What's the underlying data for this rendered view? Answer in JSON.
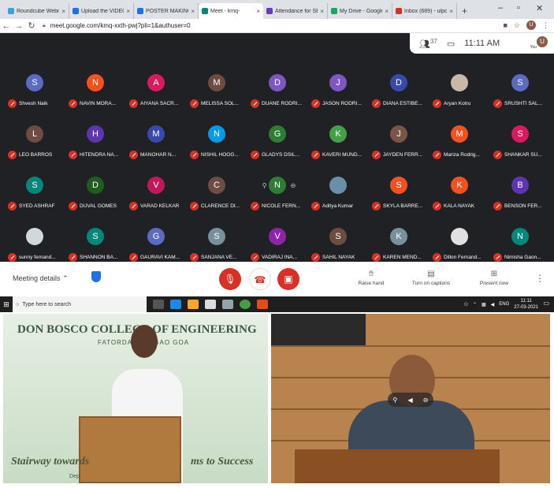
{
  "browser": {
    "tabs": [
      {
        "title": "Roundcube Webm",
        "color": "#37a3d8"
      },
      {
        "title": "Upload the VIDEO",
        "color": "#1a73e8"
      },
      {
        "title": "POSTER MAKING",
        "color": "#1a73e8"
      },
      {
        "title": "Meet - kmq-",
        "color": "#00897b",
        "active": true
      },
      {
        "title": "Attendance for SE",
        "color": "#673ab7"
      },
      {
        "title": "My Drive - Google",
        "color": "#1fa463"
      },
      {
        "title": "Inbox (689) - ulpo",
        "color": "#d93025"
      }
    ],
    "url": "meet.google.com/kmq-xxth-pwj?pli=1&authuser=0",
    "profile_initial": "U"
  },
  "meet": {
    "participant_count": "37",
    "time": "11:11 AM",
    "you_label": "You",
    "you_initial": "U",
    "participants": [
      [
        {
          "initial": "S",
          "name": "Shvesh Naik",
          "color": "#5c6bc0"
        },
        {
          "initial": "N",
          "name": "NAVIN MORA...",
          "color": "#f4511e"
        },
        {
          "initial": "A",
          "name": "AIYANA SACR...",
          "color": "#d81b60"
        },
        {
          "initial": "M",
          "name": "MELISSA SOL...",
          "color": "#6d4c41"
        },
        {
          "initial": "D",
          "name": "DUANE RODRI...",
          "color": "#7e57c2"
        },
        {
          "initial": "J",
          "name": "JASON RODRI...",
          "color": "#7e57c2"
        },
        {
          "initial": "D",
          "name": "DIANA ESTIBE...",
          "color": "#3949ab"
        },
        {
          "initial": "",
          "name": "Aryan Kotru",
          "color": "#c9b8a8"
        },
        {
          "initial": "S",
          "name": "SRUSHTI SAL...",
          "color": "#5c6bc0"
        }
      ],
      [
        {
          "initial": "L",
          "name": "LEO BARROS",
          "color": "#6d4c41"
        },
        {
          "initial": "H",
          "name": "HITENDRA NA...",
          "color": "#5e35b1"
        },
        {
          "initial": "M",
          "name": "MANOHAR N...",
          "color": "#3949ab"
        },
        {
          "initial": "N",
          "name": "NISHIL HOOG...",
          "color": "#039be5"
        },
        {
          "initial": "G",
          "name": "GLADYS DSIL...",
          "color": "#2e7d32"
        },
        {
          "initial": "K",
          "name": "KAVERI MUND...",
          "color": "#43a047"
        },
        {
          "initial": "J",
          "name": "JAYDEN FERR...",
          "color": "#795548"
        },
        {
          "initial": "M",
          "name": "Mariza Rodrig...",
          "color": "#f4511e"
        },
        {
          "initial": "S",
          "name": "SHANKAR SU...",
          "color": "#d81b60"
        }
      ],
      [
        {
          "initial": "S",
          "name": "SYED ASHRAF",
          "color": "#00897b"
        },
        {
          "initial": "D",
          "name": "DUVAL GOMES",
          "color": "#1b5e20"
        },
        {
          "initial": "V",
          "name": "VARAD KELKAR",
          "color": "#c2185b"
        },
        {
          "initial": "C",
          "name": "CLARENCE DI...",
          "color": "#6d4c41"
        },
        {
          "initial": "N",
          "name": "NICOLE FERN...",
          "color": "#2e7d32"
        },
        {
          "initial": "",
          "name": "Aditya Kumar",
          "color": "#6a8fa8"
        },
        {
          "initial": "S",
          "name": "SKYLA BARRE...",
          "color": "#f4511e"
        },
        {
          "initial": "K",
          "name": "KALA NAYAK",
          "color": "#f4511e"
        },
        {
          "initial": "B",
          "name": "BENSON FER...",
          "color": "#5e35b1"
        }
      ],
      [
        {
          "initial": "",
          "name": "sunny fernand...",
          "color": "#cfd8dc"
        },
        {
          "initial": "S",
          "name": "SHANNON BA...",
          "color": "#00897b"
        },
        {
          "initial": "G",
          "name": "GAURAVI KAM...",
          "color": "#5c6bc0"
        },
        {
          "initial": "S",
          "name": "SANJANA VE...",
          "color": "#78909c"
        },
        {
          "initial": "V",
          "name": "VADIRAJ INA...",
          "color": "#8e24aa"
        },
        {
          "initial": "S",
          "name": "SAHIL NAYAK",
          "color": "#6d4c41"
        },
        {
          "initial": "K",
          "name": "KAREN MEND...",
          "color": "#78909c"
        },
        {
          "initial": "",
          "name": "Dillon Fernand...",
          "color": "#e0e0e0"
        },
        {
          "initial": "N",
          "name": "Nimisha Gaon...",
          "color": "#00897b"
        }
      ]
    ]
  },
  "controls": {
    "meeting_details": "Meeting details",
    "raise_hand": "Raise hand",
    "captions": "Turn on captions",
    "present": "Present now"
  },
  "taskbar": {
    "search_placeholder": "Type here to search",
    "lang": "ENG",
    "time": "11:11",
    "date": "27-03-2021"
  },
  "videos": {
    "banner_title": "DON BOSCO COLLEGE OF ENGINEERING",
    "banner_place": "FATORDA, MARGAO GOA",
    "banner_left": "Stairway towards",
    "banner_right": "ms to Success",
    "banner_dept": "Dep"
  }
}
